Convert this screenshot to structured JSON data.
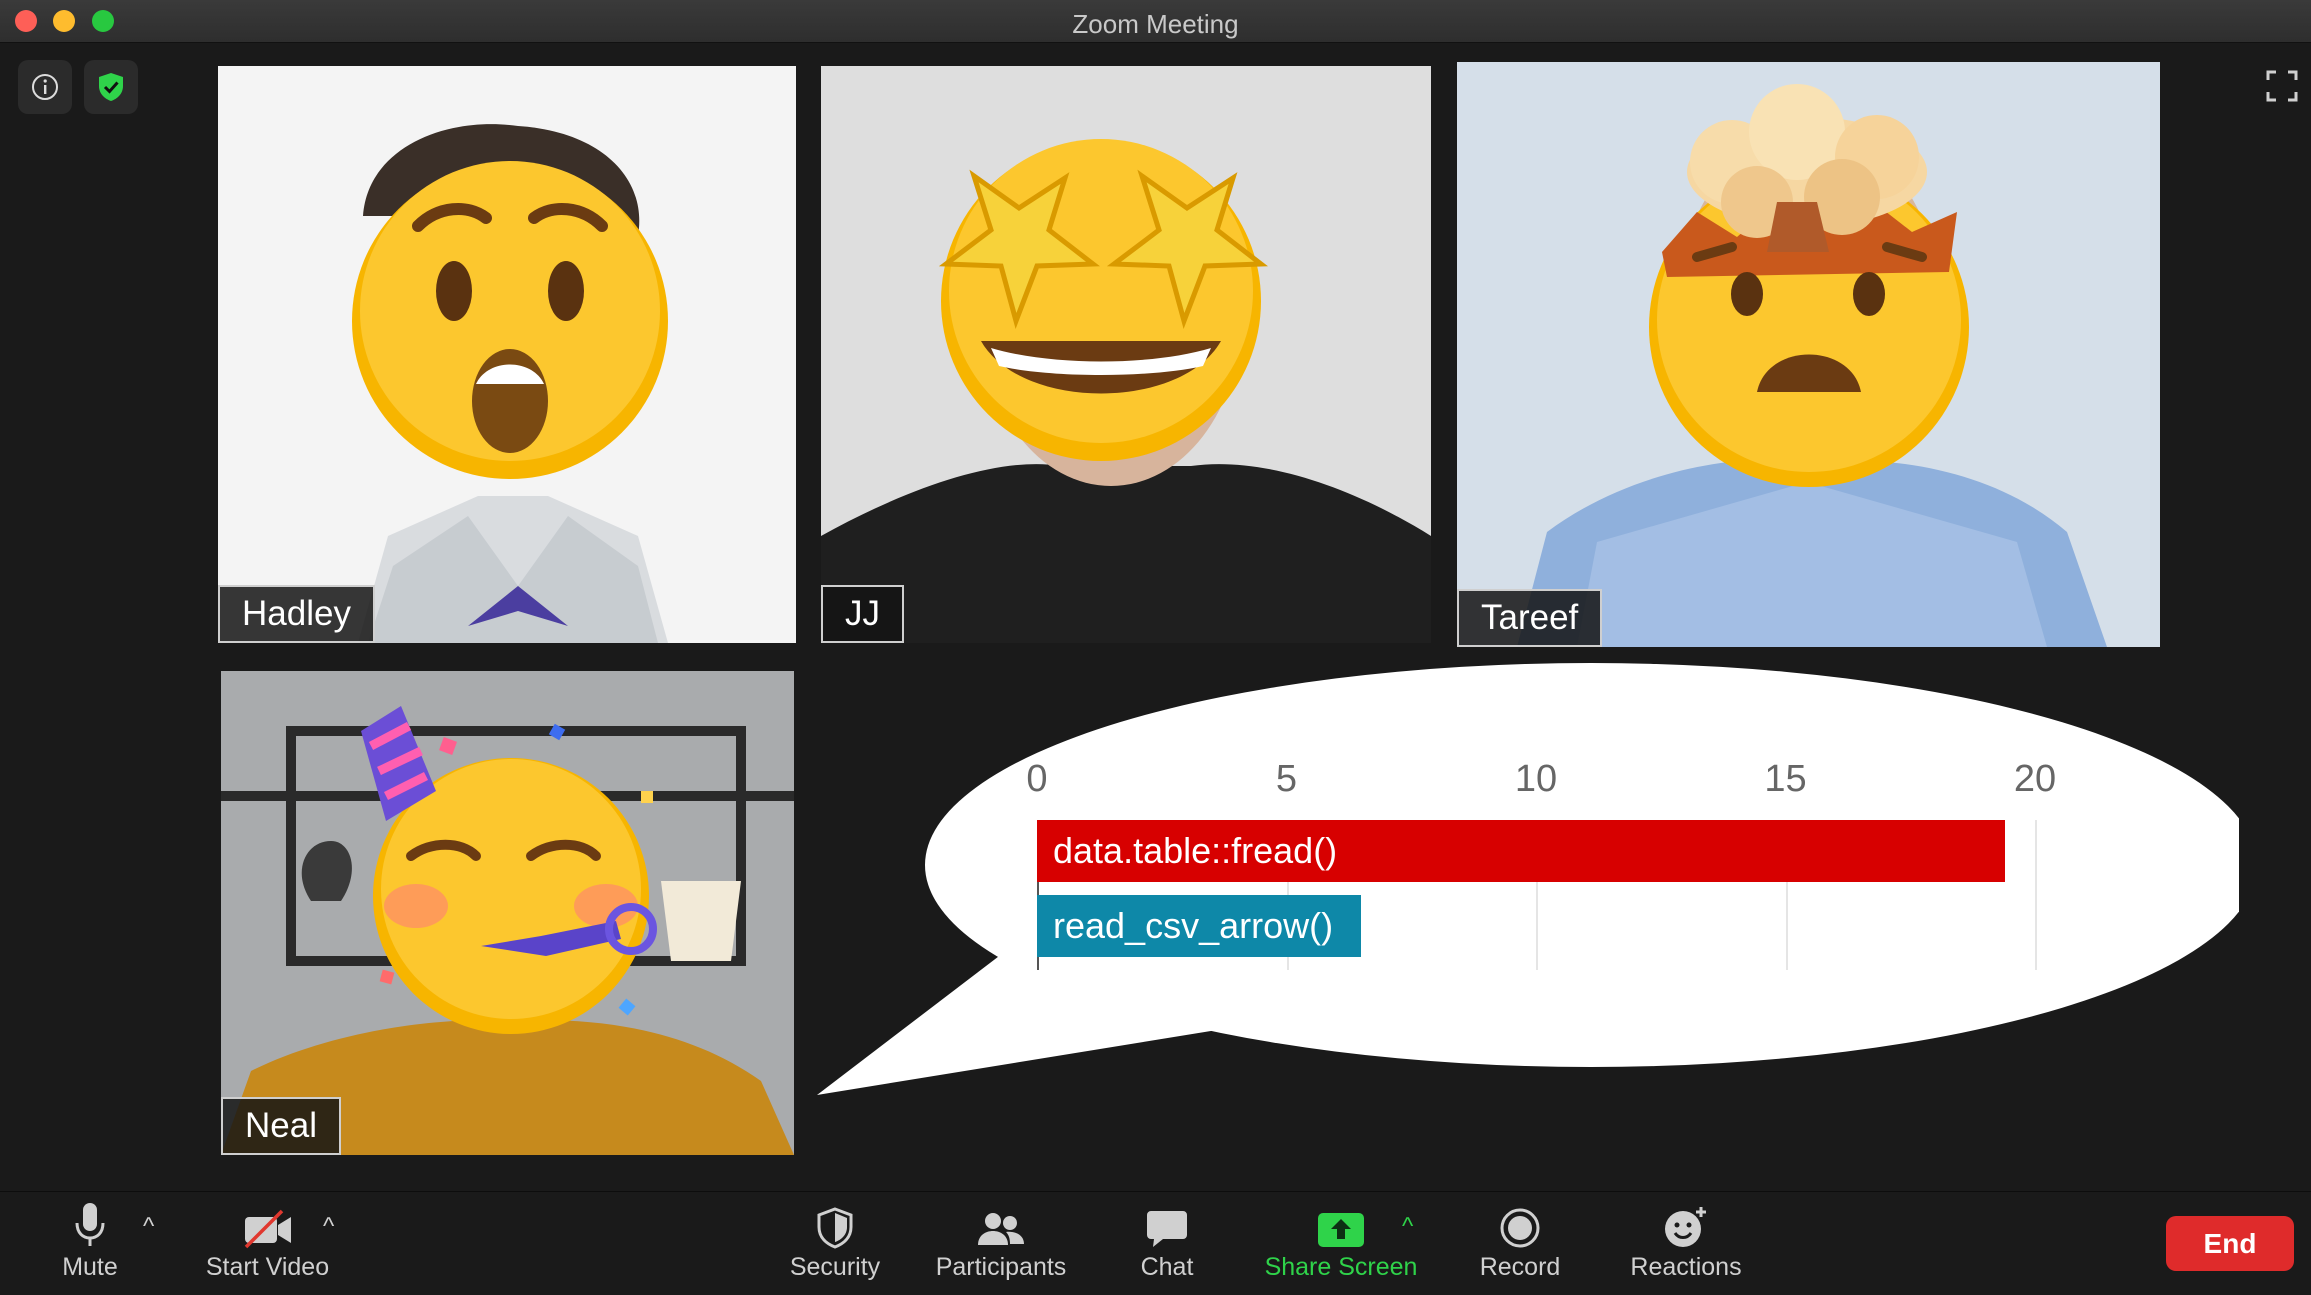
{
  "window": {
    "title": "Zoom Meeting"
  },
  "participants": [
    {
      "name": "Hadley",
      "emoji": "astonished-face"
    },
    {
      "name": "JJ",
      "emoji": "star-struck-face"
    },
    {
      "name": "Tareef",
      "emoji": "exploding-head"
    },
    {
      "name": "Neal",
      "emoji": "partying-face"
    }
  ],
  "chart_data": {
    "type": "bar",
    "orientation": "horizontal",
    "categories": [
      "data.table::fread()",
      "read_csv_arrow()"
    ],
    "values": [
      19.4,
      6.5
    ],
    "bar_colors": [
      "#d70000",
      "#0e88a8"
    ],
    "xticks": [
      "0",
      "5",
      "10",
      "15",
      "20"
    ],
    "xlim": [
      0,
      20
    ],
    "grid": true
  },
  "toolbar": {
    "mute_label": "Mute",
    "video_label": "Start Video",
    "security_label": "Security",
    "participants_label": "Participants",
    "chat_label": "Chat",
    "share_label": "Share Screen",
    "record_label": "Record",
    "reactions_label": "Reactions",
    "end_label": "End",
    "caret": "^"
  },
  "colors": {
    "share_accent": "#2fd34a",
    "end_button": "#df2b2b",
    "shield_green": "#2fd34a"
  },
  "icons": [
    "info-icon",
    "shield-check-icon",
    "fullscreen-icon",
    "microphone-icon",
    "video-off-icon",
    "security-shield-icon",
    "participants-icon",
    "chat-icon",
    "share-screen-icon",
    "record-icon",
    "reactions-icon"
  ]
}
